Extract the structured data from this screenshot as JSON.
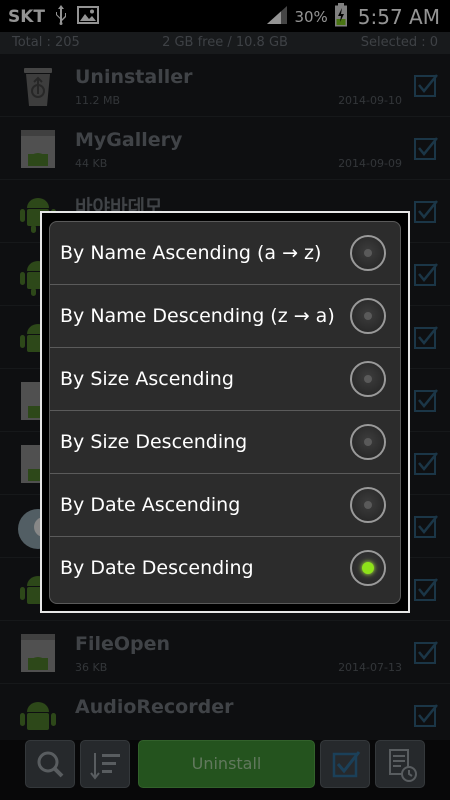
{
  "status_bar": {
    "carrier": "SKT",
    "battery_percent": "30%",
    "time": "5:57 AM",
    "icons": [
      "usb-icon",
      "gallery-icon",
      "signal-icon",
      "battery-charging-icon"
    ]
  },
  "info_bar": {
    "total": "Total : 205",
    "storage": "2 GB free / 10.8 GB",
    "selected": "Selected : 0"
  },
  "apps": [
    {
      "name": "Uninstaller",
      "size": "11.2 MB",
      "date": "2014-09-10",
      "icon": "recycle-bin-icon"
    },
    {
      "name": "MyGallery",
      "size": "44 KB",
      "date": "2014-09-09",
      "icon": "android-doc-icon"
    },
    {
      "name": "바야바데모",
      "size": "",
      "date": "",
      "icon": "android-icon"
    },
    {
      "name": "",
      "size": "",
      "date": "",
      "icon": "android-icon"
    },
    {
      "name": "",
      "size": "",
      "date": "",
      "icon": "android-icon"
    },
    {
      "name": "",
      "size": "",
      "date": "",
      "icon": "android-doc-icon"
    },
    {
      "name": "",
      "size": "",
      "date": "",
      "icon": "android-doc-icon"
    },
    {
      "name": "",
      "size": "",
      "date": "",
      "icon": "owl-icon"
    },
    {
      "name": "",
      "size": "",
      "date": "",
      "icon": "android-icon"
    },
    {
      "name": "FileOpen",
      "size": "36 KB",
      "date": "2014-07-13",
      "icon": "android-doc-icon"
    },
    {
      "name": "AudioRecorder",
      "size": "",
      "date": "",
      "icon": "android-icon"
    }
  ],
  "sort_dialog": {
    "options": [
      {
        "label": "By Name Ascending (a → z)",
        "selected": false
      },
      {
        "label": "By Name Descending (z → a)",
        "selected": false
      },
      {
        "label": "By Size Ascending",
        "selected": false
      },
      {
        "label": "By Size Descending",
        "selected": false
      },
      {
        "label": "By Date Ascending",
        "selected": false
      },
      {
        "label": "By Date Descending",
        "selected": true
      }
    ],
    "selected_color": "#8ee21a"
  },
  "toolbar": {
    "uninstall_label": "Uninstall",
    "icons": [
      "search-icon",
      "sort-icon",
      "select-all-icon",
      "history-icon"
    ]
  },
  "colors": {
    "accent_green": "#3f8f34",
    "list_background": "#191b1e",
    "dialog_background": "#2c2c2c"
  }
}
